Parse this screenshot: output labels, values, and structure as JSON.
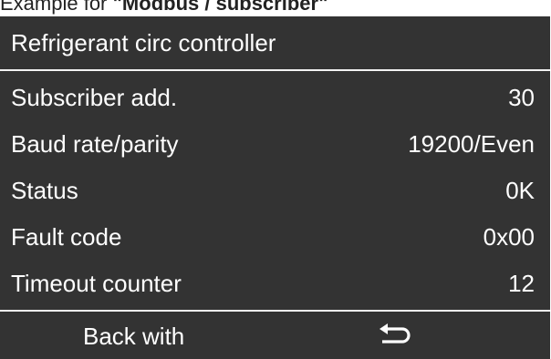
{
  "caption": {
    "prefix": "Example for ",
    "bold": "\"Modbus / subscriber\""
  },
  "display": {
    "title": "Refrigerant circ controller",
    "rows": [
      {
        "label": "Subscriber add.",
        "value": "30"
      },
      {
        "label": "Baud rate/parity",
        "value": "19200/Even"
      },
      {
        "label": "Status",
        "value": "0K"
      },
      {
        "label": "Fault code",
        "value": "0x00"
      },
      {
        "label": "Timeout counter",
        "value": "12"
      }
    ],
    "footer": {
      "back_label": "Back with",
      "back_icon": "return-arrow-icon"
    }
  }
}
